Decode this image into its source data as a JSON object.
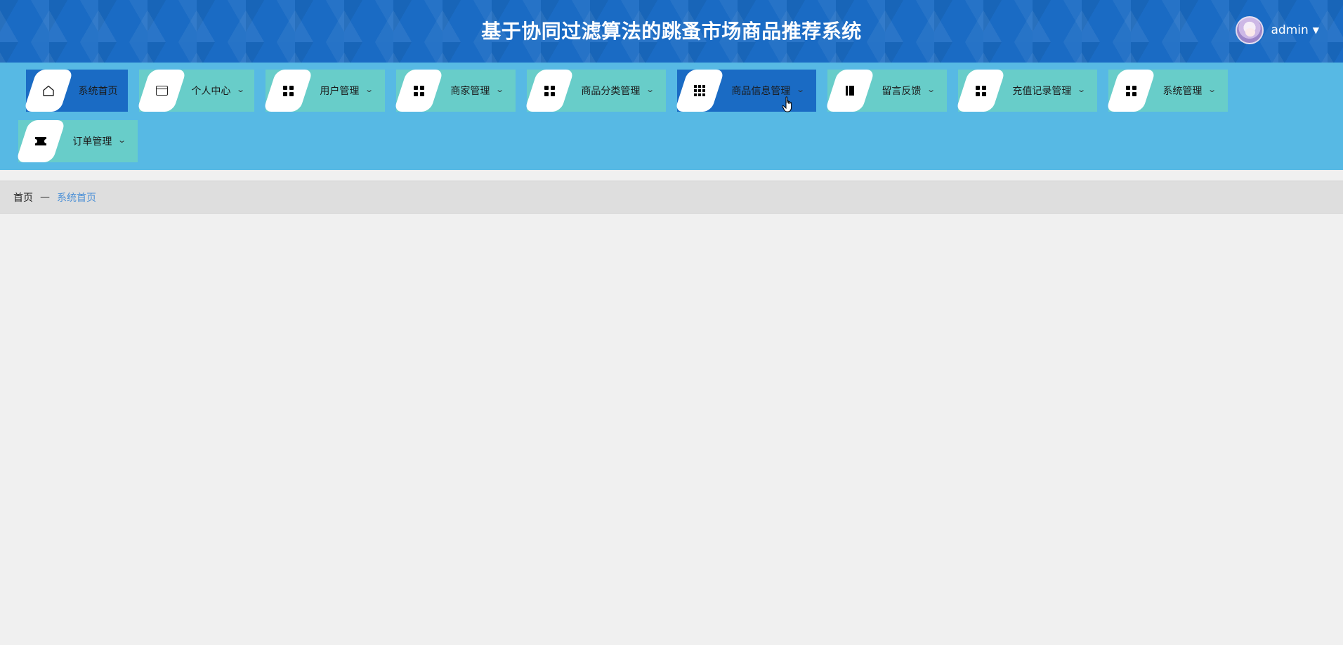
{
  "header": {
    "title": "基于协同过滤算法的跳蚤市场商品推荐系统",
    "username": "admin"
  },
  "nav": {
    "items": [
      {
        "label": "系统首页",
        "icon": "home-icon",
        "active": true,
        "has_dropdown": false
      },
      {
        "label": "个人中心",
        "icon": "wallet-icon",
        "active": false,
        "has_dropdown": true
      },
      {
        "label": "用户管理",
        "icon": "grid-icon",
        "active": false,
        "has_dropdown": true
      },
      {
        "label": "商家管理",
        "icon": "grid-icon",
        "active": false,
        "has_dropdown": true
      },
      {
        "label": "商品分类管理",
        "icon": "grid-icon",
        "active": false,
        "has_dropdown": true
      },
      {
        "label": "商品信息管理",
        "icon": "grid9-icon",
        "active": true,
        "has_dropdown": true
      },
      {
        "label": "留言反馈",
        "icon": "book-icon",
        "active": false,
        "has_dropdown": true
      },
      {
        "label": "充值记录管理",
        "icon": "grid-icon",
        "active": false,
        "has_dropdown": true
      },
      {
        "label": "系统管理",
        "icon": "grid-icon",
        "active": false,
        "has_dropdown": true
      },
      {
        "label": "订单管理",
        "icon": "ticket-icon",
        "active": false,
        "has_dropdown": true
      }
    ]
  },
  "breadcrumb": {
    "home": "首页",
    "separator": "—",
    "current": "系统首页"
  },
  "colors": {
    "header_bg": "#1a6bc4",
    "nav_bg": "#57b9e4",
    "nav_item_bg": "#68cdc9",
    "nav_item_active_bg": "#1a6bc4",
    "breadcrumb_current": "#4a8fd6"
  }
}
